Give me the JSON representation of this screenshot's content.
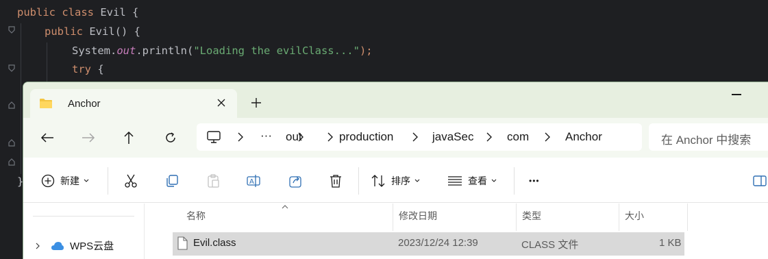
{
  "editor": {
    "lines": [
      {
        "kw": "public class ",
        "name": "Evil",
        "rest": " {"
      },
      {
        "kw": "public ",
        "name": "Evil",
        "rest": "() {"
      },
      {
        "pre": "System.",
        "field": "out",
        "mid": ".println(",
        "str": "\"Loading the evilClass...\"",
        "post": ");"
      },
      {
        "kw": "try",
        "rest": " {"
      }
    ],
    "closing_brace": "}"
  },
  "explorer": {
    "tab_title": "Anchor",
    "breadcrumbs": [
      "···",
      "out",
      "production",
      "javaSec",
      "com",
      "Anchor"
    ],
    "search_placeholder": "在 Anchor 中搜索",
    "toolbar": {
      "new_label": "新建",
      "sort_label": "排序",
      "view_label": "查看",
      "more_label": "•••"
    },
    "sidebar": {
      "items": [
        {
          "label": "WPS云盘"
        }
      ]
    },
    "columns": {
      "name": "名称",
      "modified": "修改日期",
      "type": "类型",
      "size": "大小"
    },
    "files": [
      {
        "name": "Evil.class",
        "modified": "2023/12/24 12:39",
        "type": "CLASS 文件",
        "size": "1 KB"
      }
    ],
    "colors": {
      "titlebar": "#e7efe0",
      "nav": "#f4f8f1",
      "selected_row": "#d9d9d9"
    }
  }
}
